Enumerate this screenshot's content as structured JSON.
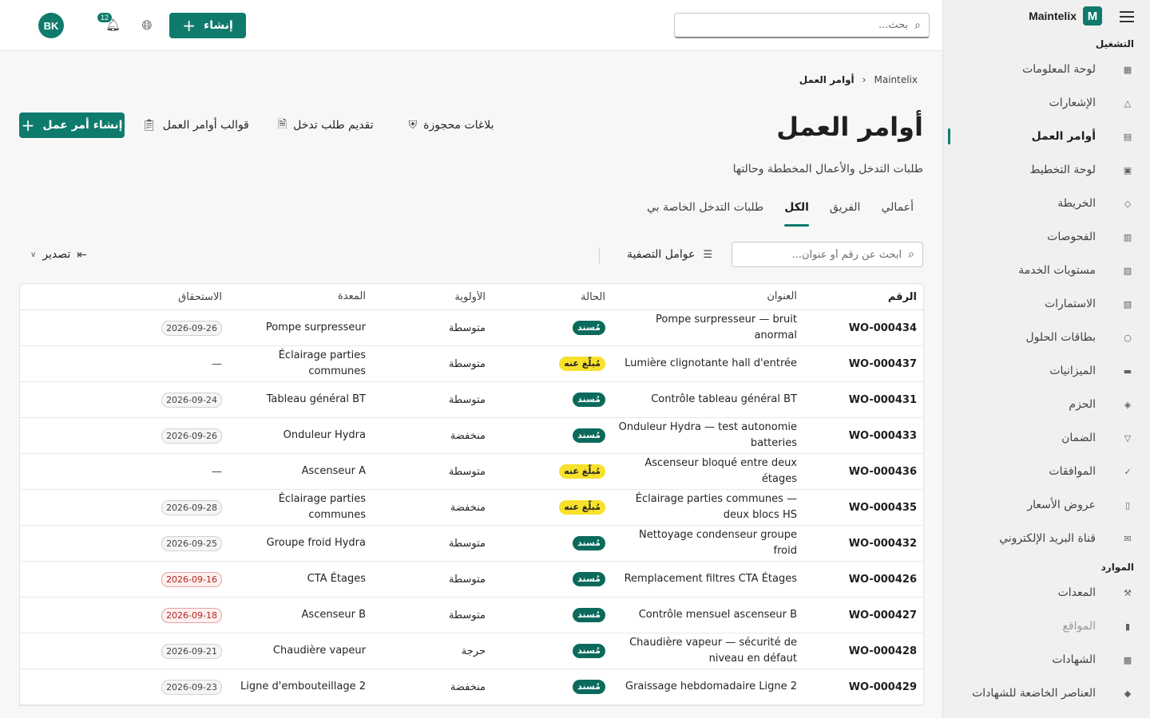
{
  "brand": {
    "name": "Maintelix",
    "logo_letter": "M"
  },
  "topbar": {
    "search_placeholder": "بحث...",
    "create_label": "إنشاء",
    "notifications_count": "12",
    "user_initials": "BK"
  },
  "sidebar": {
    "sections": [
      {
        "label": "التشغيل",
        "items": [
          {
            "label": "لوحة المعلومات",
            "icon": "dashboard-icon"
          },
          {
            "label": "الإشعارات",
            "icon": "bell-icon"
          },
          {
            "label": "أوامر العمل",
            "icon": "clipboard-icon",
            "active": true
          },
          {
            "label": "لوحة التخطيط",
            "icon": "calendar-icon"
          },
          {
            "label": "الخريطة",
            "icon": "map-icon"
          },
          {
            "label": "الفحوصات",
            "icon": "checklist-icon"
          },
          {
            "label": "مستويات الخدمة",
            "icon": "sla-icon"
          },
          {
            "label": "الاستمارات",
            "icon": "form-icon"
          },
          {
            "label": "بطاقات الحلول",
            "icon": "lightbulb-icon"
          },
          {
            "label": "الميزانيات",
            "icon": "money-icon"
          },
          {
            "label": "الحزم",
            "icon": "package-icon"
          },
          {
            "label": "الضمان",
            "icon": "shield-icon"
          },
          {
            "label": "الموافقات",
            "icon": "check-circle-icon"
          },
          {
            "label": "عروض الأسعار",
            "icon": "document-icon"
          },
          {
            "label": "قناة البريد الإلكتروني",
            "icon": "mail-icon"
          }
        ]
      },
      {
        "label": "الموارد",
        "items": [
          {
            "label": "المعدات",
            "icon": "wrench-icon"
          },
          {
            "label": "المواقع",
            "icon": "building-icon",
            "disabled": true
          },
          {
            "label": "الشهادات",
            "icon": "certificate-icon"
          },
          {
            "label": "العناصر الخاضعة للشهادات",
            "icon": "cube-icon"
          }
        ]
      }
    ]
  },
  "breadcrumb": {
    "root": "Maintelix",
    "current": "أوامر العمل"
  },
  "page": {
    "title": "أوامر العمل",
    "subtitle": "طلبات التدخل والأعمال المخططة وحالتها",
    "actions": {
      "reserved_reports": "بلاغات محجوزة",
      "submit_request": "تقديم طلب تدخل",
      "templates": "قوالب أوامر العمل",
      "create_work_order": "إنشاء أمر عمل"
    },
    "tabs": [
      "أعمالي",
      "الفريق",
      "الكل",
      "طلبات التدخل الخاصة بي"
    ],
    "active_tab": "الكل",
    "list_search_placeholder": "ابحث عن رقم أو عنوان...",
    "filters_label": "عوامل التصفية",
    "export_label": "تصدير"
  },
  "table": {
    "headers": {
      "id": "الرقم",
      "title": "العنوان",
      "status": "الحالة",
      "priority": "الأولوية",
      "equipment": "المعدة",
      "due": "الاستحقاق"
    },
    "status_colors": {
      "assigned": "#0b6a5c",
      "reported": "#f7e12b"
    },
    "rows": [
      {
        "id": "WO-000434",
        "title": "Pompe surpresseur — bruit anormal",
        "status": "مُسند",
        "status_kind": "assigned",
        "priority": "متوسطة",
        "equipment": "Pompe surpresseur",
        "due": "2026-09-26",
        "overdue": false
      },
      {
        "id": "WO-000437",
        "title": "Lumière clignotante hall d'entrée",
        "status": "مُبلّغ عنه",
        "status_kind": "reported",
        "priority": "متوسطة",
        "equipment": "Éclairage parties communes",
        "due": "—",
        "overdue": false
      },
      {
        "id": "WO-000431",
        "title": "Contrôle tableau général BT",
        "status": "مُسند",
        "status_kind": "assigned",
        "priority": "متوسطة",
        "equipment": "Tableau général BT",
        "due": "2026-09-24",
        "overdue": false
      },
      {
        "id": "WO-000433",
        "title": "Onduleur Hydra — test autonomie batteries",
        "status": "مُسند",
        "status_kind": "assigned",
        "priority": "منخفضة",
        "equipment": "Onduleur Hydra",
        "due": "2026-09-26",
        "overdue": false
      },
      {
        "id": "WO-000436",
        "title": "Ascenseur bloqué entre deux étages",
        "status": "مُبلّغ عنه",
        "status_kind": "reported",
        "priority": "متوسطة",
        "equipment": "Ascenseur A",
        "due": "—",
        "overdue": false
      },
      {
        "id": "WO-000435",
        "title": "Éclairage parties communes — deux blocs HS",
        "status": "مُبلّغ عنه",
        "status_kind": "reported",
        "priority": "منخفضة",
        "equipment": "Éclairage parties communes",
        "due": "2026-09-28",
        "overdue": false
      },
      {
        "id": "WO-000432",
        "title": "Nettoyage condenseur groupe froid",
        "status": "مُسند",
        "status_kind": "assigned",
        "priority": "متوسطة",
        "equipment": "Groupe froid Hydra",
        "due": "2026-09-25",
        "overdue": false
      },
      {
        "id": "WO-000426",
        "title": "Remplacement filtres CTA Étages",
        "status": "مُسند",
        "status_kind": "assigned",
        "priority": "متوسطة",
        "equipment": "CTA Étages",
        "due": "2026-09-16",
        "overdue": true
      },
      {
        "id": "WO-000427",
        "title": "Contrôle mensuel ascenseur B",
        "status": "مُسند",
        "status_kind": "assigned",
        "priority": "متوسطة",
        "equipment": "Ascenseur B",
        "due": "2026-09-18",
        "overdue": true
      },
      {
        "id": "WO-000428",
        "title": "Chaudière vapeur — sécurité de niveau en défaut",
        "status": "مُسند",
        "status_kind": "assigned",
        "priority": "حرجة",
        "equipment": "Chaudière vapeur",
        "due": "2026-09-21",
        "overdue": false
      },
      {
        "id": "WO-000429",
        "title": "Graissage hebdomadaire Ligne 2",
        "status": "مُسند",
        "status_kind": "assigned",
        "priority": "منخفضة",
        "equipment": "Ligne d'embouteillage 2",
        "due": "2026-09-23",
        "overdue": false
      }
    ]
  }
}
